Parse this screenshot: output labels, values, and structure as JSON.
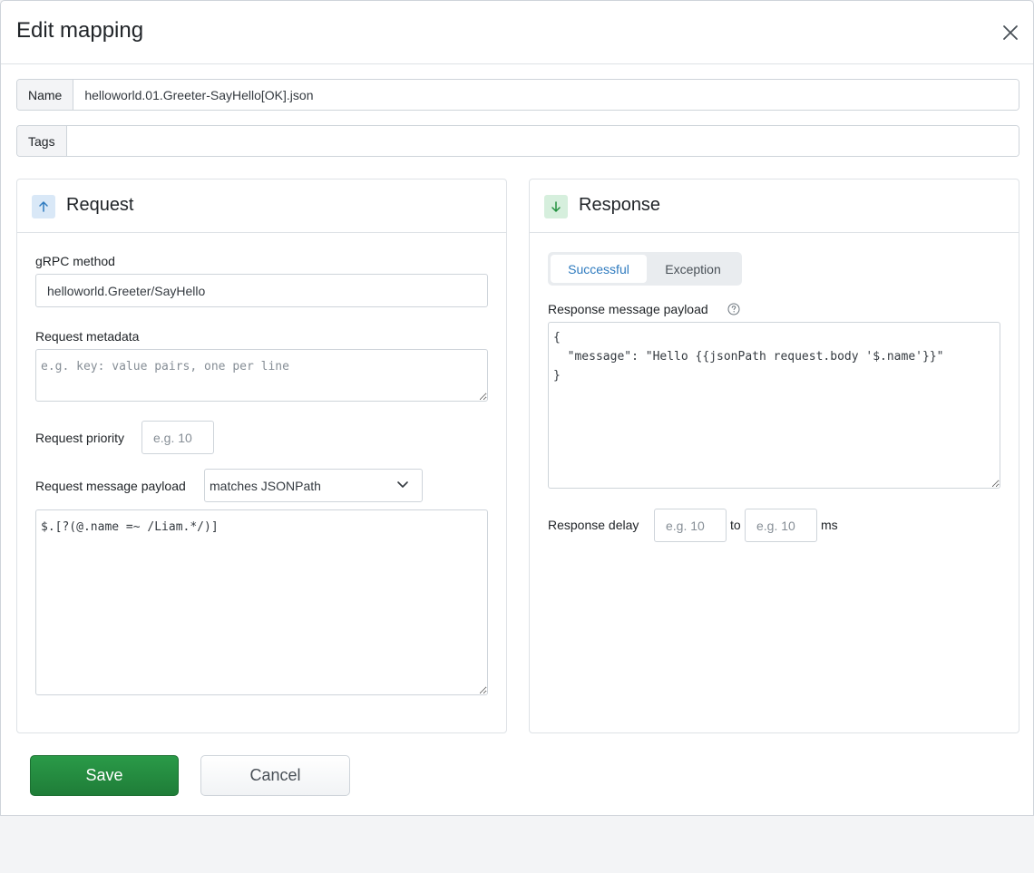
{
  "modal": {
    "title": "Edit mapping"
  },
  "name_field": {
    "label": "Name",
    "value": "helloworld.01.Greeter-SayHello[OK].json"
  },
  "tags_field": {
    "label": "Tags",
    "value": ""
  },
  "request": {
    "title": "Request",
    "grpc_method": {
      "label": "gRPC method",
      "value": "helloworld.Greeter/SayHello"
    },
    "metadata": {
      "label": "Request metadata",
      "placeholder": "e.g. key: value pairs, one per line",
      "value": ""
    },
    "priority": {
      "label": "Request priority",
      "placeholder": "e.g. 10",
      "value": ""
    },
    "payload": {
      "label": "Request message payload",
      "matcher": "matches JSONPath",
      "value": "$.[?(@.name =~ /Liam.*/)]"
    }
  },
  "response": {
    "title": "Response",
    "tabs": {
      "successful": "Successful",
      "exception": "Exception",
      "active": "Successful"
    },
    "payload": {
      "label": "Response message payload",
      "value": "{\n  \"message\": \"Hello {{jsonPath request.body '$.name'}}\"\n}"
    },
    "delay": {
      "label": "Response delay",
      "from_placeholder": "e.g. 10",
      "to_label": "to",
      "to_placeholder": "e.g. 10",
      "unit": "ms"
    }
  },
  "buttons": {
    "save": "Save",
    "cancel": "Cancel"
  },
  "colors": {
    "primary_blue": "#2f7bbf",
    "save_green": "#22903f",
    "up_icon_bg": "#d9e8f7",
    "down_icon_bg": "#d6efdd"
  },
  "icons": {
    "close": "close-icon",
    "request": "arrow-up-icon",
    "response": "arrow-down-icon",
    "select": "chevron-down-icon",
    "help": "question-circle-icon"
  }
}
